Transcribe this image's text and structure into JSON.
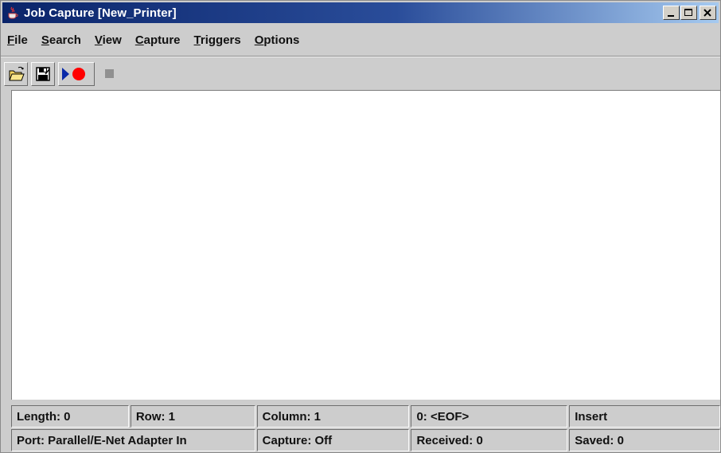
{
  "window": {
    "title": "Job Capture [New_Printer]",
    "controls": {
      "minimize": "minimize-icon",
      "maximize": "maximize-icon",
      "close": "close-icon"
    }
  },
  "menu": {
    "items": [
      {
        "label": "File",
        "mnemonic": "F"
      },
      {
        "label": "Search",
        "mnemonic": "S"
      },
      {
        "label": "View",
        "mnemonic": "V"
      },
      {
        "label": "Capture",
        "mnemonic": "C"
      },
      {
        "label": "Triggers",
        "mnemonic": "T"
      },
      {
        "label": "Options",
        "mnemonic": "O"
      }
    ]
  },
  "toolbar": {
    "buttons": [
      {
        "icon": "open-folder-icon"
      },
      {
        "icon": "save-disk-icon"
      },
      {
        "icon": "record-icon"
      },
      {
        "icon": "stop-icon"
      }
    ]
  },
  "editor": {
    "content": ""
  },
  "status": {
    "length": "Length: 0",
    "row": "Row: 1",
    "column": "Column: 1",
    "char": "0: <EOF>",
    "mode": "Insert",
    "port": "Port: Parallel/E-Net Adapter In",
    "capture": "Capture: Off",
    "received": "Received: 0",
    "saved": "Saved: 0"
  },
  "colors": {
    "title_active": "#0a246a",
    "title_fade": "#a6caf0",
    "window_bg": "#cdcdcd",
    "record_red": "#ff0000",
    "record_arrow": "#0a2aa8",
    "stop_disabled": "#909090"
  }
}
